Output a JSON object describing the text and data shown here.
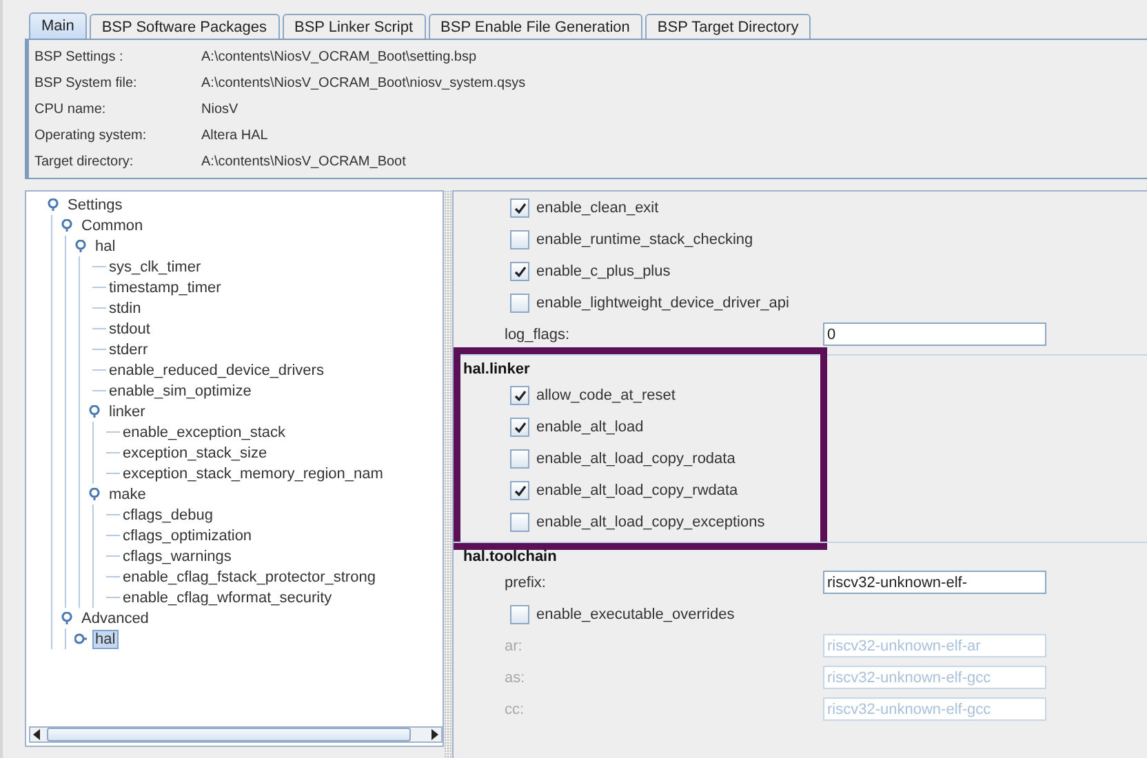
{
  "tabs": [
    {
      "label": "Main",
      "selected": true
    },
    {
      "label": "BSP Software Packages",
      "selected": false
    },
    {
      "label": "BSP Linker Script",
      "selected": false
    },
    {
      "label": "BSP Enable File Generation",
      "selected": false
    },
    {
      "label": "BSP Target Directory",
      "selected": false
    }
  ],
  "info": [
    {
      "label": "BSP Settings :",
      "value": "A:\\contents\\NiosV_OCRAM_Boot\\setting.bsp"
    },
    {
      "label": "BSP System file:",
      "value": "A:\\contents\\NiosV_OCRAM_Boot\\niosv_system.qsys"
    },
    {
      "label": "CPU name:",
      "value": "NiosV"
    },
    {
      "label": "Operating system:",
      "value": "Altera HAL"
    },
    {
      "label": "Target directory:",
      "value": "A:\\contents\\NiosV_OCRAM_Boot"
    }
  ],
  "tree": [
    {
      "label": "Settings",
      "selected": false,
      "expanded": true,
      "children": [
        {
          "label": "Common",
          "selected": false,
          "expanded": true,
          "children": [
            {
              "label": "hal",
              "selected": false,
              "expanded": true,
              "children": [
                {
                  "label": "sys_clk_timer",
                  "selected": false
                },
                {
                  "label": "timestamp_timer",
                  "selected": false
                },
                {
                  "label": "stdin",
                  "selected": false
                },
                {
                  "label": "stdout",
                  "selected": false
                },
                {
                  "label": "stderr",
                  "selected": false
                },
                {
                  "label": "enable_reduced_device_drivers",
                  "selected": false
                },
                {
                  "label": "enable_sim_optimize",
                  "selected": false
                },
                {
                  "label": "linker",
                  "selected": false,
                  "expanded": true,
                  "children": [
                    {
                      "label": "enable_exception_stack",
                      "selected": false
                    },
                    {
                      "label": "exception_stack_size",
                      "selected": false
                    },
                    {
                      "label": "exception_stack_memory_region_nam",
                      "selected": false
                    }
                  ]
                },
                {
                  "label": "make",
                  "selected": false,
                  "expanded": true,
                  "children": [
                    {
                      "label": "cflags_debug",
                      "selected": false
                    },
                    {
                      "label": "cflags_optimization",
                      "selected": false
                    },
                    {
                      "label": "cflags_warnings",
                      "selected": false
                    },
                    {
                      "label": "enable_cflag_fstack_protector_strong",
                      "selected": false
                    },
                    {
                      "label": "enable_cflag_wformat_security",
                      "selected": false
                    }
                  ]
                }
              ]
            }
          ]
        },
        {
          "label": "Advanced",
          "selected": false,
          "expanded": true,
          "children": [
            {
              "label": "hal",
              "selected": true,
              "expanded": false
            }
          ]
        }
      ]
    }
  ],
  "sections": [
    {
      "highlighted": false,
      "items": [
        {
          "kind": "checkbox",
          "label": "enable_clean_exit",
          "checked": true
        },
        {
          "kind": "checkbox",
          "label": "enable_runtime_stack_checking",
          "checked": false
        },
        {
          "kind": "checkbox",
          "label": "enable_c_plus_plus",
          "checked": true
        },
        {
          "kind": "checkbox",
          "label": "enable_lightweight_device_driver_api",
          "checked": false
        },
        {
          "kind": "field",
          "label": "log_flags:",
          "value": "0",
          "disabled": false
        }
      ]
    },
    {
      "title": "hal.linker",
      "highlighted": true,
      "items": [
        {
          "kind": "checkbox",
          "label": "allow_code_at_reset",
          "checked": true
        },
        {
          "kind": "checkbox",
          "label": "enable_alt_load",
          "checked": true
        },
        {
          "kind": "checkbox",
          "label": "enable_alt_load_copy_rodata",
          "checked": false
        },
        {
          "kind": "checkbox",
          "label": "enable_alt_load_copy_rwdata",
          "checked": true
        },
        {
          "kind": "checkbox",
          "label": "enable_alt_load_copy_exceptions",
          "checked": false
        }
      ]
    },
    {
      "title": "hal.toolchain",
      "highlighted": false,
      "items": [
        {
          "kind": "field",
          "label": "prefix:",
          "value": "riscv32-unknown-elf-",
          "disabled": false
        },
        {
          "kind": "checkbox",
          "label": "enable_executable_overrides",
          "checked": false
        },
        {
          "kind": "field",
          "label": "ar:",
          "value": "riscv32-unknown-elf-ar",
          "disabled": true
        },
        {
          "kind": "field",
          "label": "as:",
          "value": "riscv32-unknown-elf-gcc",
          "disabled": true
        },
        {
          "kind": "field",
          "label": "cc:",
          "value": "riscv32-unknown-elf-gcc",
          "disabled": true
        }
      ]
    }
  ]
}
